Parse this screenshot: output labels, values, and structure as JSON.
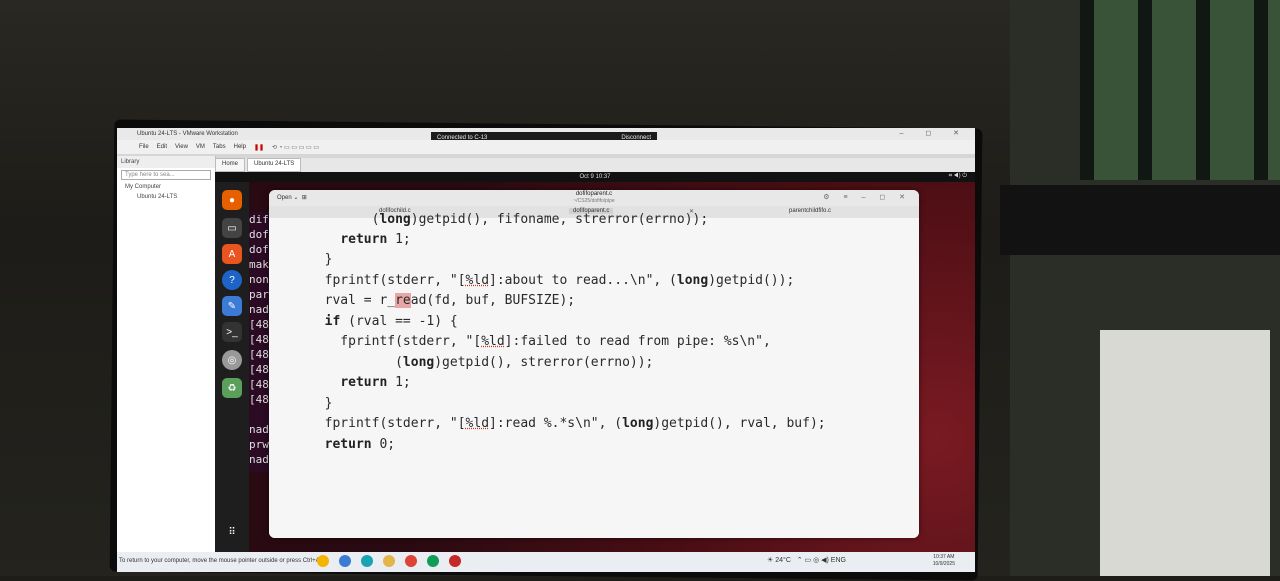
{
  "vmware": {
    "title": "Ubuntu 24-LTS - VMware Workstation",
    "menu": [
      "File",
      "Edit",
      "View",
      "VM",
      "Tabs",
      "Help"
    ],
    "connection": "Connected to C-13",
    "disconnect": "Disconnect"
  },
  "library": {
    "header": "Library",
    "search_placeholder": "Type here to sea...",
    "items": [
      "My Computer",
      "Ubuntu 24-LTS"
    ]
  },
  "vm_tabs": [
    "Home",
    "Ubuntu 24-LTS"
  ],
  "ubuntu": {
    "clock": "Oct 9  10:37",
    "terminal_lines": [
      "dif",
      "dof",
      "dof",
      "mak",
      "non",
      "par",
      "nad",
      "[48",
      "[48",
      "[48",
      "[48",
      "[48",
      "[48",
      "",
      "nad",
      "prw",
      "nad"
    ]
  },
  "gedit": {
    "open_label": "Open",
    "title": "dofifoparent.c",
    "subtitle": "~/CS25/dofifo/pipe",
    "tabs": [
      "dofifochild.c",
      "dofifoparent.c",
      "parentchildfifo.c"
    ],
    "code": [
      "        (long)getpid(), fifoname, strerror(errno));",
      "    return 1;",
      "  }",
      "  fprintf(stderr, \"[%ld]:about to read...\\n\", (long)getpid());",
      "  rval = r_read(fd, buf, BUFSIZE);",
      "  if (rval == -1) {",
      "    fprintf(stderr, \"[%ld]:failed to read from pipe: %s\\n\",",
      "           (long)getpid(), strerror(errno));",
      "    return 1;",
      "  }",
      "  fprintf(stderr, \"[%ld]:read %.*s\\n\", (long)getpid(), rval, buf);",
      "  return 0;",
      "}"
    ]
  },
  "taskbar": {
    "hint": "To return to your computer, move the mouse pointer outside or press Ctrl+Alt.",
    "weather": "24°C",
    "lang": "ENG",
    "time": "10:37 AM",
    "date": "10/9/2025"
  }
}
